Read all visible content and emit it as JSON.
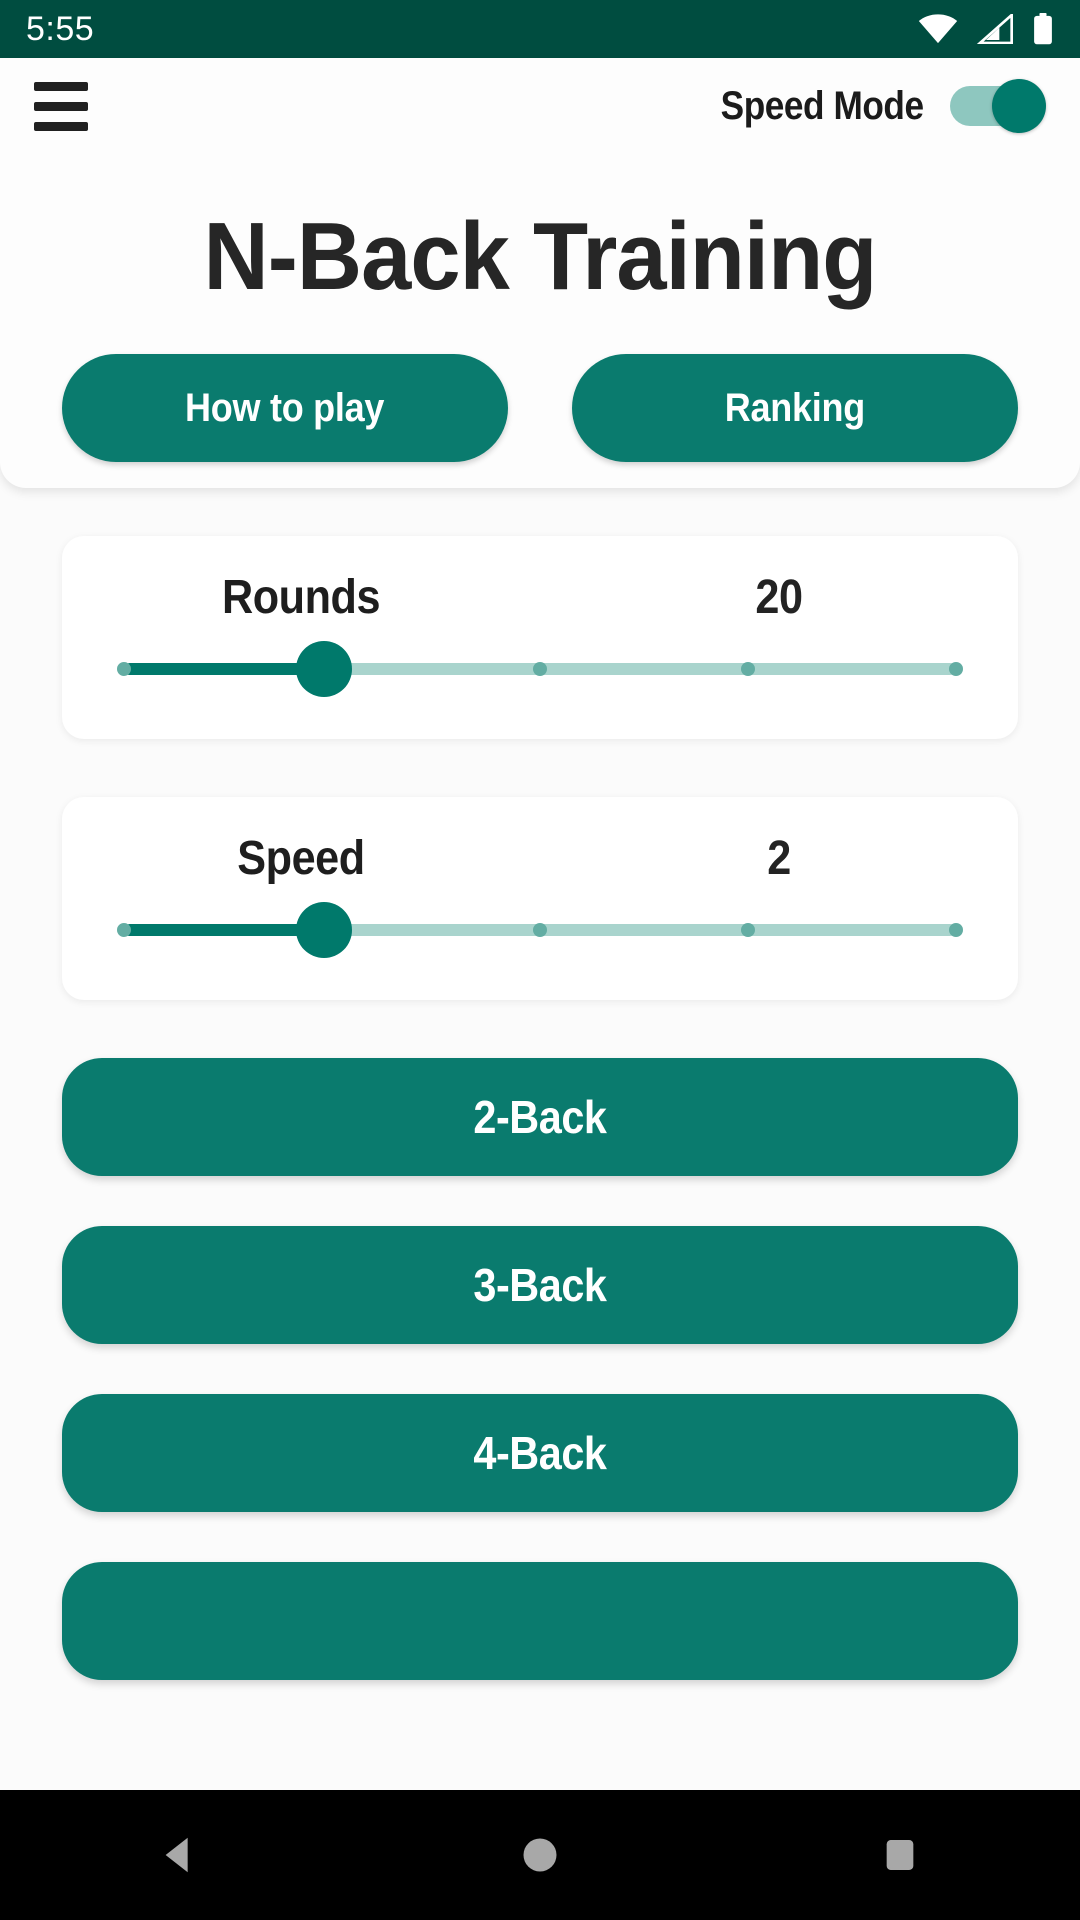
{
  "status_bar": {
    "time": "5:55",
    "icons": [
      "wifi-icon",
      "cellular-signal-icon",
      "battery-icon"
    ],
    "background": "#004D40"
  },
  "app_bar": {
    "menu_icon": "hamburger-menu-icon",
    "speed_mode_label": "Speed Mode",
    "speed_mode_enabled": true
  },
  "header": {
    "title": "N-Back Training",
    "how_to_play_label": "How to play",
    "ranking_label": "Ranking"
  },
  "settings": [
    {
      "name": "rounds",
      "label": "Rounds",
      "value": "20",
      "slider_percent": 24,
      "ticks": [
        0,
        50,
        75,
        100
      ]
    },
    {
      "name": "speed",
      "label": "Speed",
      "value": "2",
      "slider_percent": 24,
      "ticks": [
        0,
        50,
        75,
        100
      ]
    }
  ],
  "nback_buttons": [
    {
      "name": "2-back",
      "label": "2-Back"
    },
    {
      "name": "3-back",
      "label": "3-Back"
    },
    {
      "name": "4-back",
      "label": "4-Back"
    },
    {
      "name": "5-back",
      "label": ""
    }
  ],
  "nav_bar": {
    "back_label": "back-button",
    "home_label": "home-button",
    "recents_label": "recents-button"
  },
  "colors": {
    "status_bar": "#004D40",
    "primary": "#0A7B6E",
    "accent": "#00796B",
    "track_light": "#A9D4CD",
    "page_bg": "#FBFBFB"
  }
}
